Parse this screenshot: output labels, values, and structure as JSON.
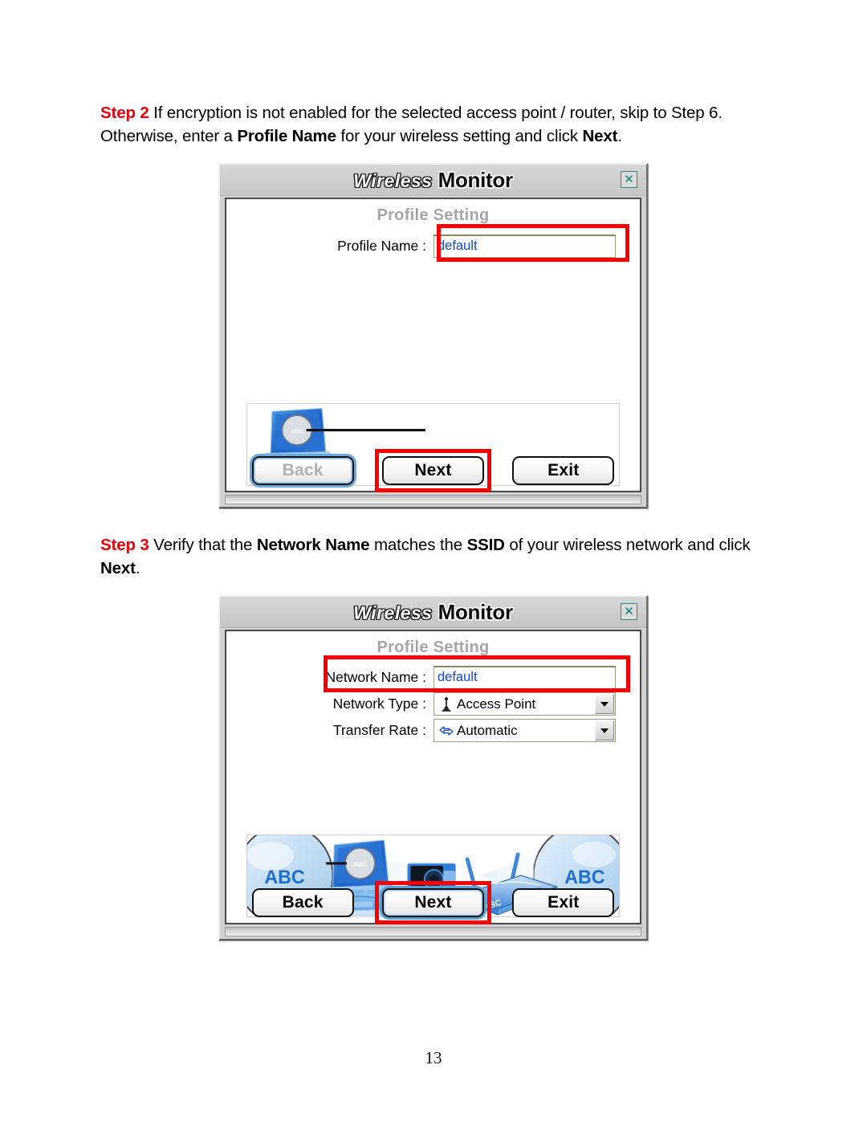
{
  "page": {
    "number": "13"
  },
  "steps": [
    {
      "id": "step-2",
      "label": "Step 2",
      "text_parts": [
        {
          "t": " If encryption is not enabled for the selected access point / router, skip to Step 6. Otherwise, enter a ",
          "bold": false
        },
        {
          "t": "Profile Name",
          "bold": true
        },
        {
          "t": " for your wireless setting and click ",
          "bold": false
        },
        {
          "t": "Next",
          "bold": true
        },
        {
          "t": ".",
          "bold": false
        }
      ]
    },
    {
      "id": "step-3",
      "label": "Step 3",
      "text_parts": [
        {
          "t": " Verify that the ",
          "bold": false
        },
        {
          "t": "Network Name",
          "bold": true
        },
        {
          "t": " matches the ",
          "bold": false
        },
        {
          "t": "SSID",
          "bold": true
        },
        {
          "t": " of your wireless network and click ",
          "bold": false
        },
        {
          "t": "Next",
          "bold": true
        },
        {
          "t": ".",
          "bold": false
        }
      ]
    }
  ],
  "dialog1": {
    "title": {
      "part1": "Wireless",
      "part2": "Monitor"
    },
    "close_label": "✕",
    "heading": "Profile Setting",
    "fields": [
      {
        "label": "Profile Name :",
        "value": "default",
        "type": "text",
        "highlighted": true
      }
    ],
    "illustration_alt": "laptop-with-abc-label",
    "buttons": [
      {
        "label": "Back",
        "state": "disabled",
        "highlighted": false
      },
      {
        "label": "Next",
        "state": "normal",
        "highlighted": true
      },
      {
        "label": "Exit",
        "state": "normal",
        "highlighted": false
      }
    ]
  },
  "dialog2": {
    "title": {
      "part1": "Wireless",
      "part2": "Monitor"
    },
    "close_label": "✕",
    "heading": "Profile Setting",
    "fields": [
      {
        "label": "Network Name :",
        "value": "default",
        "type": "text",
        "highlighted": true
      },
      {
        "label": "Network Type :",
        "value": "Access Point",
        "type": "combo",
        "icon": "access-point-icon",
        "highlighted": false
      },
      {
        "label": "Transfer Rate :",
        "value": "Automatic",
        "type": "combo",
        "icon": "transfer-rate-icon",
        "highlighted": false
      }
    ],
    "illustration_alt": "wireless-network-diagram-abc",
    "illustration_labels": {
      "left": "ABC",
      "right": "ABC",
      "router": "ABC",
      "laptop": "ABC"
    },
    "buttons": [
      {
        "label": "Back",
        "state": "normal",
        "highlighted": false
      },
      {
        "label": "Next",
        "state": "focused",
        "highlighted": true
      },
      {
        "label": "Exit",
        "state": "normal",
        "highlighted": false
      }
    ]
  },
  "colors": {
    "step_label_red": "#e8000d",
    "annotation_red": "#f70000",
    "input_text_blue": "#1344e0",
    "heading_gray": "#a6a6a6",
    "illustration_blue": "#1f6fd0"
  }
}
